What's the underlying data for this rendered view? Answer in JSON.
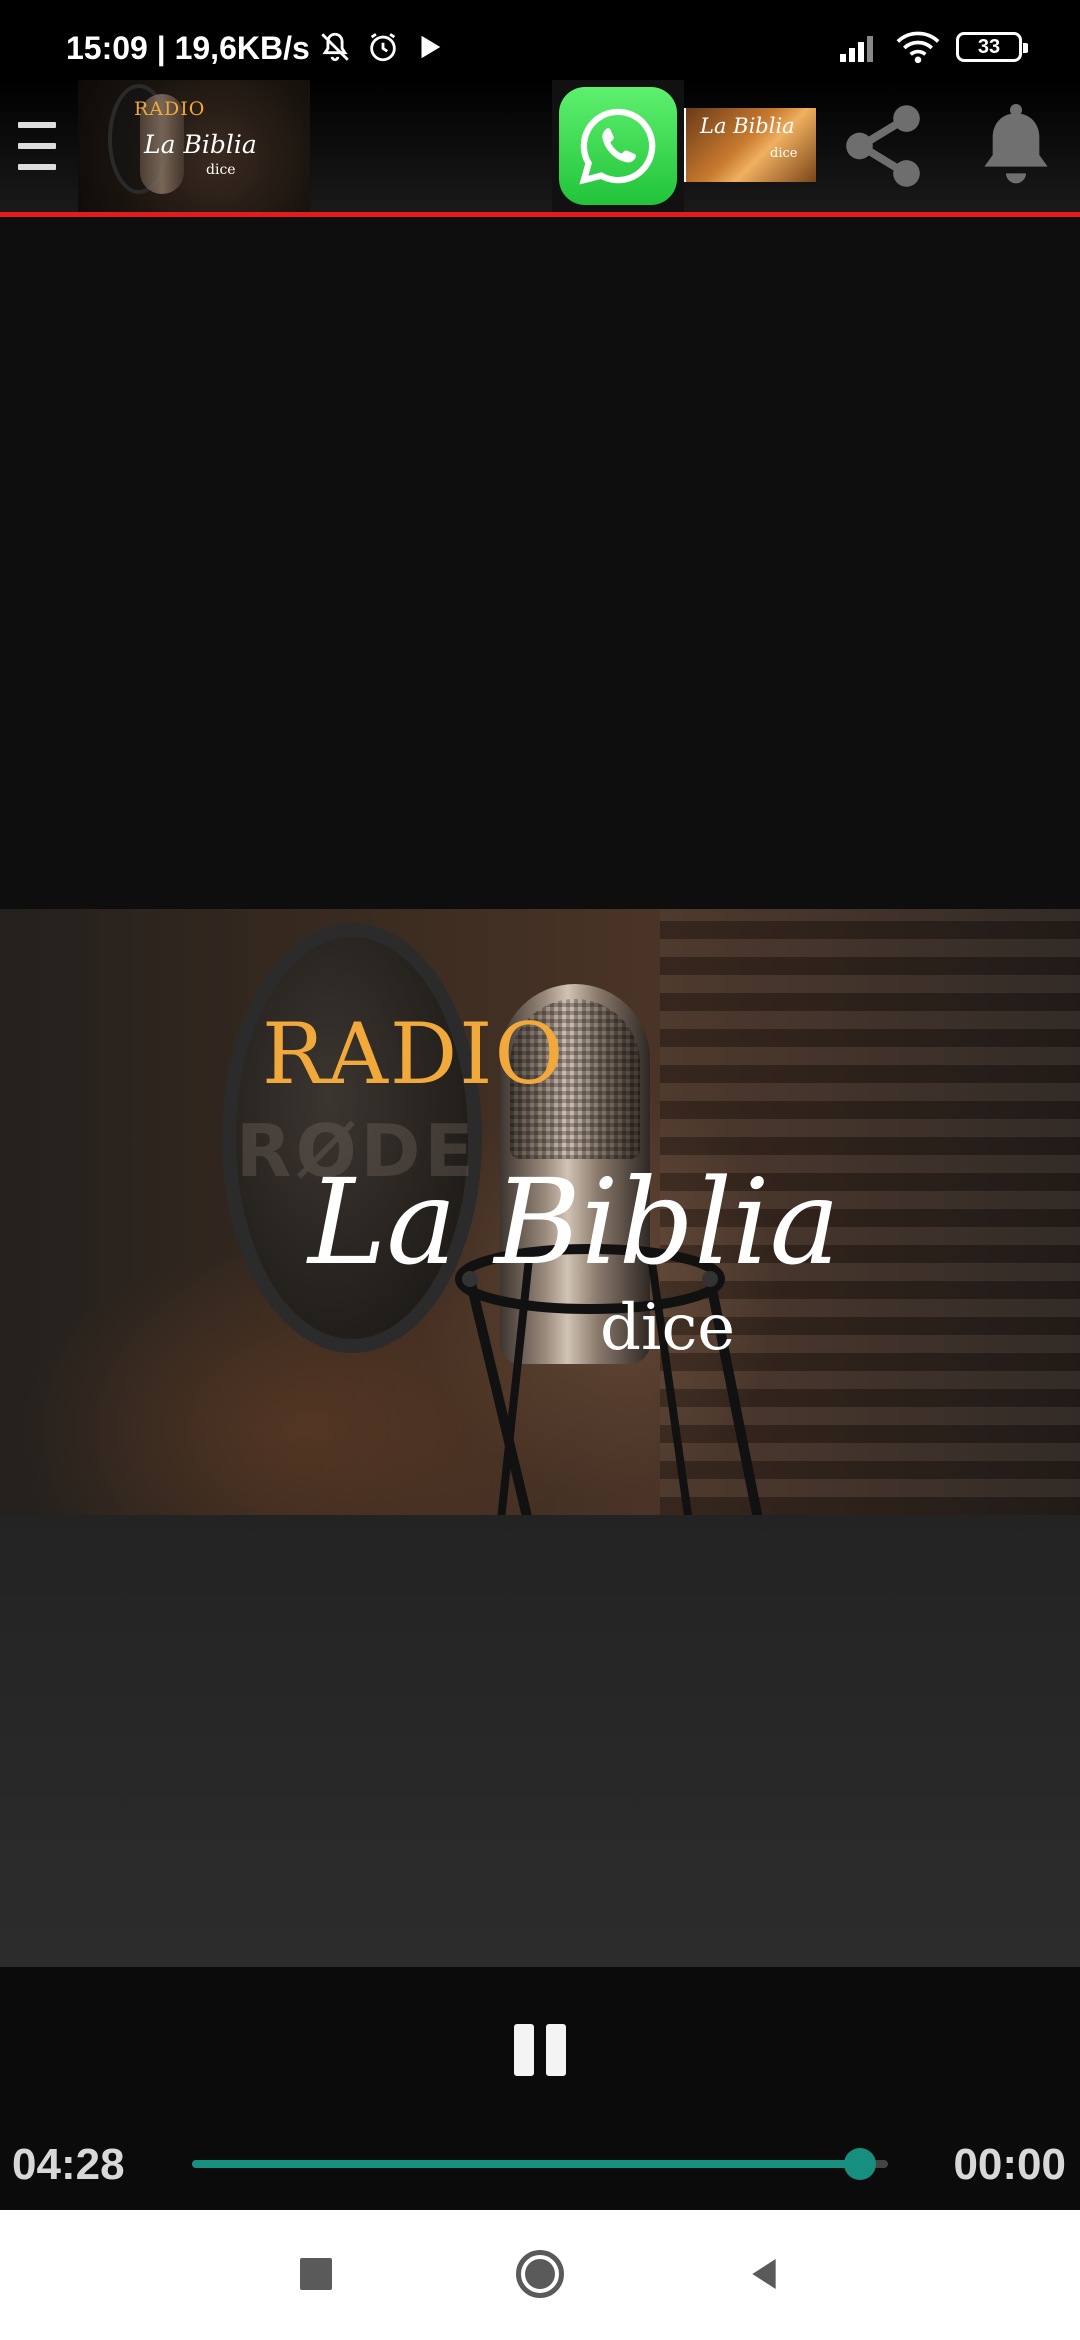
{
  "status_bar": {
    "time": "15:09",
    "speed": "19,6KB/s",
    "battery": "33"
  },
  "toolbar": {
    "logo": {
      "radio": "RADIO",
      "title": "La Biblia",
      "sub": "dice"
    },
    "biblia_thumb": {
      "title": "La Biblia",
      "sub": "dice"
    }
  },
  "hero": {
    "radio": "RADIO",
    "title": "La Biblia",
    "sub": "dice",
    "mic_brand": "RØDE"
  },
  "player": {
    "elapsed": "04:28",
    "remaining": "00:00",
    "progress": 0.96
  },
  "colors": {
    "accent_line": "#e31b1b",
    "seek": "#168f7f",
    "radio_text": "#f2a93b"
  }
}
